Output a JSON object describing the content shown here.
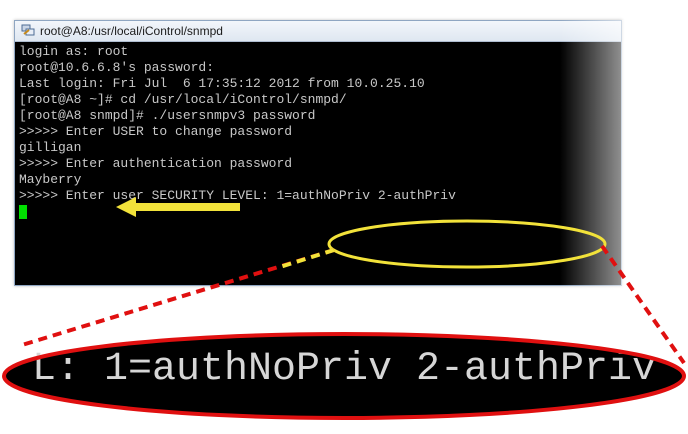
{
  "window": {
    "title": "root@A8:/usr/local/iControl/snmpd"
  },
  "terminal": {
    "lines": [
      "login as: root",
      "root@10.6.6.8's password:",
      "Last login: Fri Jul  6 17:35:12 2012 from 10.0.25.10",
      "[root@A8 ~]# cd /usr/local/iControl/snmpd/",
      "[root@A8 snmpd]# ./usersnmpv3 password",
      ">>>>> Enter USER to change password",
      "gilligan",
      ">>>>> Enter authentication password",
      "Mayberry",
      ">>>>> Enter user SECURITY LEVEL: 1=authNoPriv 2-authPriv"
    ]
  },
  "zoom": {
    "text": "L: 1=authNoPriv 2-authPriv"
  },
  "colors": {
    "terminal_bg": "#000000",
    "terminal_fg": "#c8c8c8",
    "cursor": "#00e000",
    "arrow": "#f2e23a",
    "callout_dashes": "#e01010",
    "ellipse_yellow": "#f2e23a",
    "ellipse_red": "#e01010"
  },
  "icons": {
    "title_icon": "putty-icon",
    "arrow": "arrow-left-icon"
  }
}
